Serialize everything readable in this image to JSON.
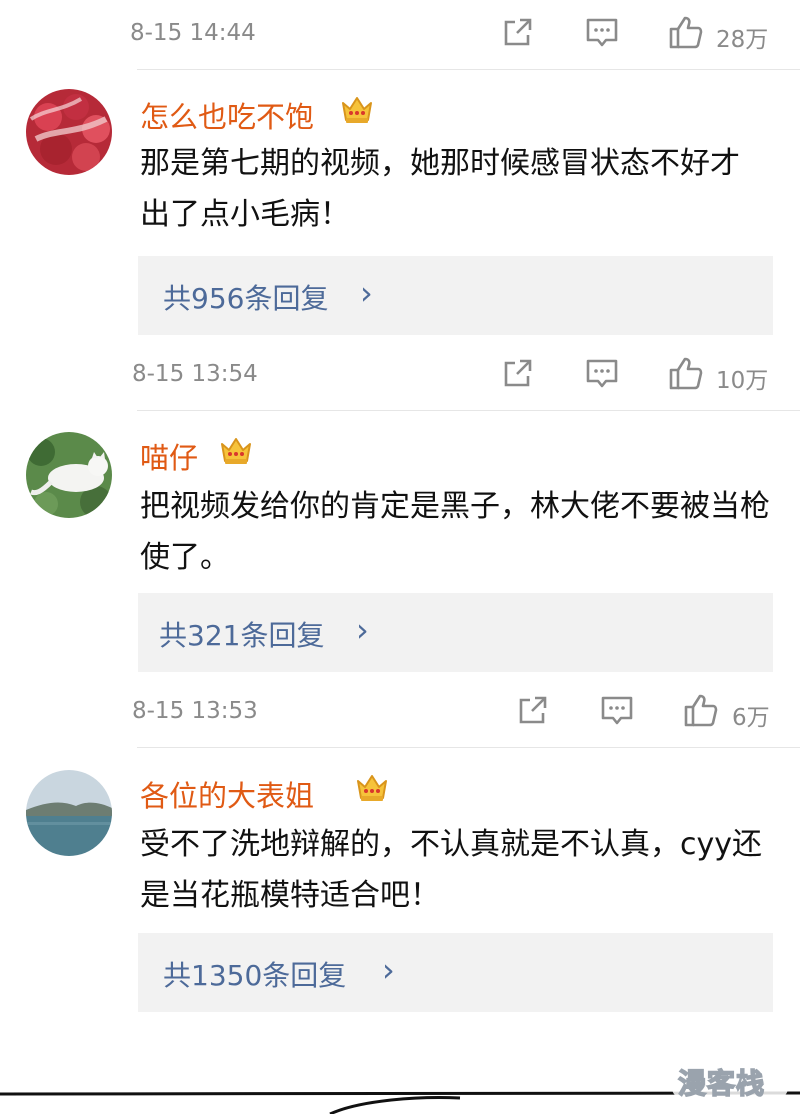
{
  "comments": [
    {
      "time": "8-15 14:44",
      "likes": "28万",
      "user": "",
      "text": "",
      "replies": ""
    },
    {
      "user": "怎么也吃不饱",
      "text": "那是第七期的视频，她那时候感冒状态不好才出了点小毛病！",
      "replies": "共956条回复",
      "time": "8-15 13:54",
      "likes": "10万"
    },
    {
      "user": "喵仔",
      "text": "把视频发给你的肯定是黑子，林大佬不要被当枪使了。",
      "replies": "共321条回复",
      "time": "8-15 13:53",
      "likes": "6万"
    },
    {
      "user": "各位的大表姐",
      "text": "受不了洗地辩解的，不认真就是不认真，cyy还是当花瓶模特适合吧！",
      "replies": "共1350条回复",
      "time": "",
      "likes": ""
    }
  ],
  "reply_arrow": "›",
  "watermark": "漫客栈",
  "icons": [
    "share-icon",
    "comment-icon",
    "like-icon",
    "vip-crown-icon"
  ],
  "colors": {
    "username": "#e05a14",
    "reply_link": "#4d6a99",
    "meta_gray": "#8a8a8a",
    "reply_bg": "#f2f2f2"
  }
}
